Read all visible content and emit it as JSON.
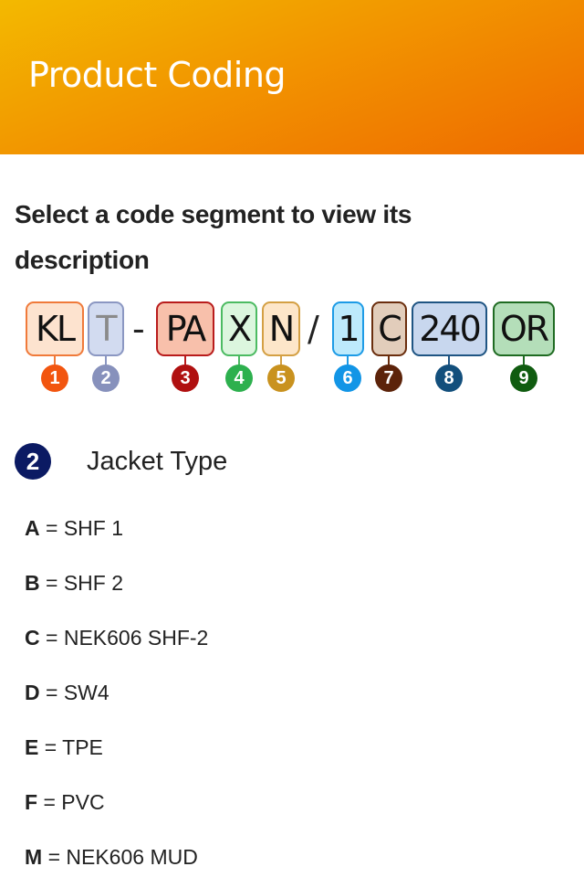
{
  "app_bar": {
    "title": "Product Coding",
    "gradient": [
      "#f3b900",
      "#ee6a00"
    ]
  },
  "prompt": "Select a code segment to view its description",
  "code": {
    "segments": [
      {
        "index": "1",
        "text": "KL",
        "fill": "#fde3cf",
        "border": "#f07a3a",
        "badge": "#f2550f",
        "selected": false
      },
      {
        "index": "2",
        "text": "T",
        "fill": "#d2dbf0",
        "border": "#8b97c2",
        "badge": "#8791bc",
        "selected": true
      },
      {
        "index": "3",
        "text": "PA",
        "fill": "#f8c0ab",
        "border": "#b91c1c",
        "badge": "#b01010",
        "selected": false
      },
      {
        "index": "4",
        "text": "X",
        "fill": "#dcf6de",
        "border": "#4cbb62",
        "badge": "#2db04e",
        "selected": false
      },
      {
        "index": "5",
        "text": "N",
        "fill": "#fde6c9",
        "border": "#d4a044",
        "badge": "#c9921f",
        "selected": false
      },
      {
        "index": "6",
        "text": "1",
        "fill": "#bdeafc",
        "border": "#1d9be6",
        "badge": "#1295e6",
        "selected": false
      },
      {
        "index": "7",
        "text": "C",
        "fill": "#e2cdbb",
        "border": "#6b2e0e",
        "badge": "#5c230a",
        "selected": false
      },
      {
        "index": "8",
        "text": "240",
        "fill": "#c8d7ee",
        "border": "#1f5583",
        "badge": "#134f7c",
        "selected": false
      },
      {
        "index": "9",
        "text": "OR",
        "fill": "#b4deb9",
        "border": "#1f6b22",
        "badge": "#105c10",
        "selected": false
      }
    ],
    "separators": [
      "-",
      "/"
    ]
  },
  "section": {
    "badge": "2",
    "title": "Jacket Type",
    "options": [
      {
        "code": "A",
        "label": "= SHF 1"
      },
      {
        "code": "B",
        "label": "= SHF 2"
      },
      {
        "code": "C",
        "label": "= NEK606 SHF-2"
      },
      {
        "code": "D",
        "label": "= SW4"
      },
      {
        "code": "E",
        "label": "= TPE"
      },
      {
        "code": "F",
        "label": "= PVC"
      },
      {
        "code": "M",
        "label": "= NEK606 MUD"
      }
    ]
  }
}
